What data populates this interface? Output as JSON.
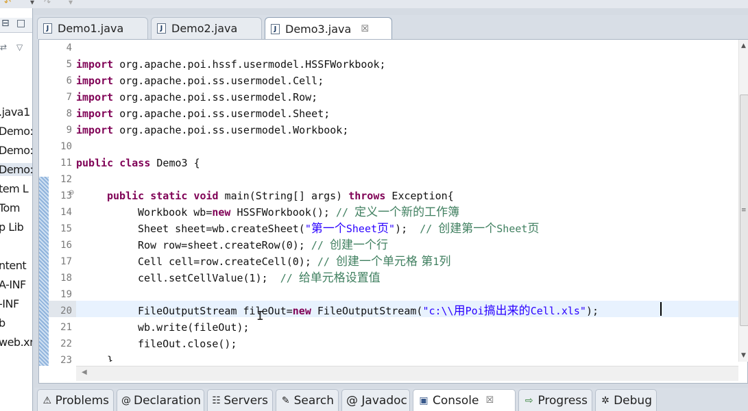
{
  "editor_tabs": [
    {
      "label": "Demo1.java"
    },
    {
      "label": "Demo2.java"
    },
    {
      "label": "Demo3.java",
      "close": "☒"
    }
  ],
  "left_panel": {
    "items": [
      ".java1",
      "Demo:",
      "Demo:",
      "Demo:",
      "tem L",
      "Tom",
      "p Lib",
      "ntent",
      "A-INF",
      "-INF",
      "b",
      "web.xr"
    ]
  },
  "code": {
    "line_numbers": [
      "4",
      "5",
      "6",
      "7",
      "8",
      "9",
      "10",
      "11",
      "12",
      "13",
      "14",
      "15",
      "16",
      "17",
      "18",
      "19",
      "20",
      "21",
      "22",
      "23"
    ],
    "import_kw": "import",
    "imports": [
      "org.apache.poi.hssf.usermodel.HSSFWorkbook;",
      "org.apache.poi.ss.usermodel.Cell;",
      "org.apache.poi.ss.usermodel.Row;",
      "org.apache.poi.ss.usermodel.Sheet;",
      "org.apache.poi.ss.usermodel.Workbook;"
    ],
    "class_kw": "public class",
    "class_rest": " Demo3 {",
    "main_kw1": "public static void",
    "main_mid": " main(String[] args) ",
    "main_kw2": "throws",
    "main_rest": " Exception{",
    "l14_a": "Workbook wb=",
    "l14_kw": "new",
    "l14_b": " HSSFWorkbook(); ",
    "l14_c1": "// ",
    "l14_c2": "定义一个新的工作簿",
    "l15_a": "Sheet sheet=wb.createSheet(",
    "l15_s1": "\"",
    "l15_s2": "第一个",
    "l15_s3": "Sheet",
    "l15_s4": "页",
    "l15_s5": "\"",
    "l15_b": ");  ",
    "l15_c1": "// ",
    "l15_c2": "创建第一个",
    "l15_c3": "Sheet",
    "l15_c4": "页",
    "l16_a": "Row row=sheet.createRow(0); ",
    "l16_c1": "// ",
    "l16_c2": "创建一个行",
    "l17_a": "Cell cell=row.createCell(0); ",
    "l17_c1": "// ",
    "l17_c2": "创建一个单元格 第",
    "l17_c3": "1",
    "l17_c4": "列",
    "l18_a": "cell.setCellValue(1);  ",
    "l18_c1": "// ",
    "l18_c2": "给单元格设置值",
    "l20_a": "FileOutputStream fileOut=",
    "l20_kw": "new",
    "l20_b": " FileOutputStream(",
    "l20_s1": "\"c:\\\\",
    "l20_s2": "用",
    "l20_s3": "Poi",
    "l20_s4": "搞出来的",
    "l20_s5": "Cell",
    "l20_s6": ".xls\"",
    "l20_c": ");",
    "l21": "wb.write(fileOut);",
    "l22": "fileOut.close();",
    "l23": "}"
  },
  "bottom_tabs": [
    {
      "label": "Problems",
      "icon": "problems-icon",
      "glyph": "⚠"
    },
    {
      "label": "Declaration",
      "icon": "declaration-icon",
      "glyph": "@"
    },
    {
      "label": "Servers",
      "icon": "servers-icon",
      "glyph": "☷"
    },
    {
      "label": "Search",
      "icon": "search-icon",
      "glyph": "✎"
    },
    {
      "label": "@ Javadoc",
      "icon": "javadoc-icon",
      "glyph": ""
    },
    {
      "label": "Console",
      "icon": "console-icon",
      "glyph": "▣",
      "close": "☒"
    },
    {
      "label": "Progress",
      "icon": "progress-icon",
      "glyph": "⇨"
    },
    {
      "label": "Debug",
      "icon": "debug-icon",
      "glyph": "✲"
    }
  ],
  "colors": {
    "keyword": "#7f0055",
    "comment": "#3f7f5f",
    "string": "#2a00ff",
    "current_line": "#e8f2fe"
  }
}
